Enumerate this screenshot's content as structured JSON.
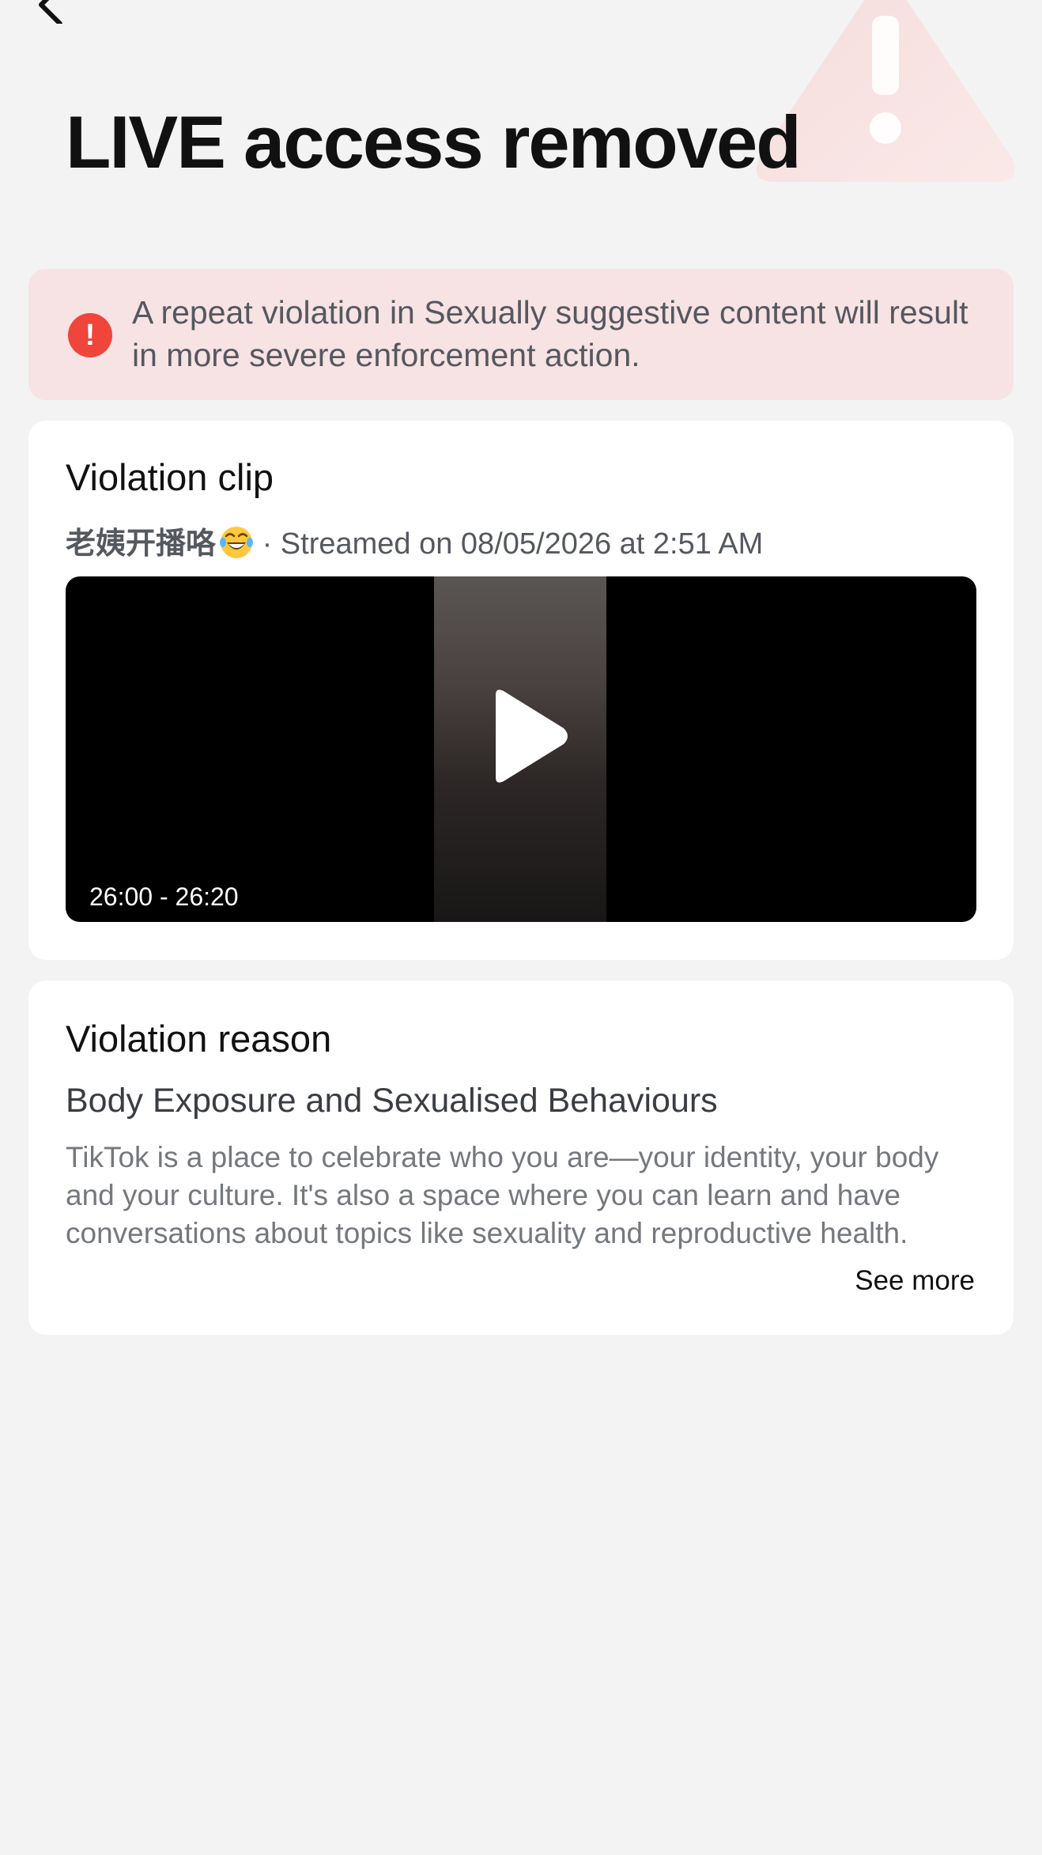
{
  "header": {
    "back_icon": "chevron-left-icon",
    "decor_icon": "warning-triangle-icon",
    "title": "LIVE access removed"
  },
  "banner": {
    "icon": "exclamation-circle-icon",
    "text": "A repeat violation in Sexually suggestive content will result in more severe enforcement action.",
    "background": "#f7e2e4",
    "icon_color": "#f0453a"
  },
  "clip": {
    "title": "Violation clip",
    "author": "老姨开播咯",
    "emoji": "face-with-tears-of-joy-emoji",
    "separator": " · ",
    "streamed": "Streamed on 08/05/2026 at 2:51 AM",
    "time_range": "26:00 - 26:20",
    "play_icon": "play-icon"
  },
  "reason": {
    "title": "Violation reason",
    "heading": "Body Exposure and Sexualised Behaviours",
    "description": "TikTok is a place to celebrate who you are—your identity, your body and your culture. It's also a space where you can learn and have conversations about topics like sexuality and reproductive health.",
    "see_more": "See more"
  }
}
